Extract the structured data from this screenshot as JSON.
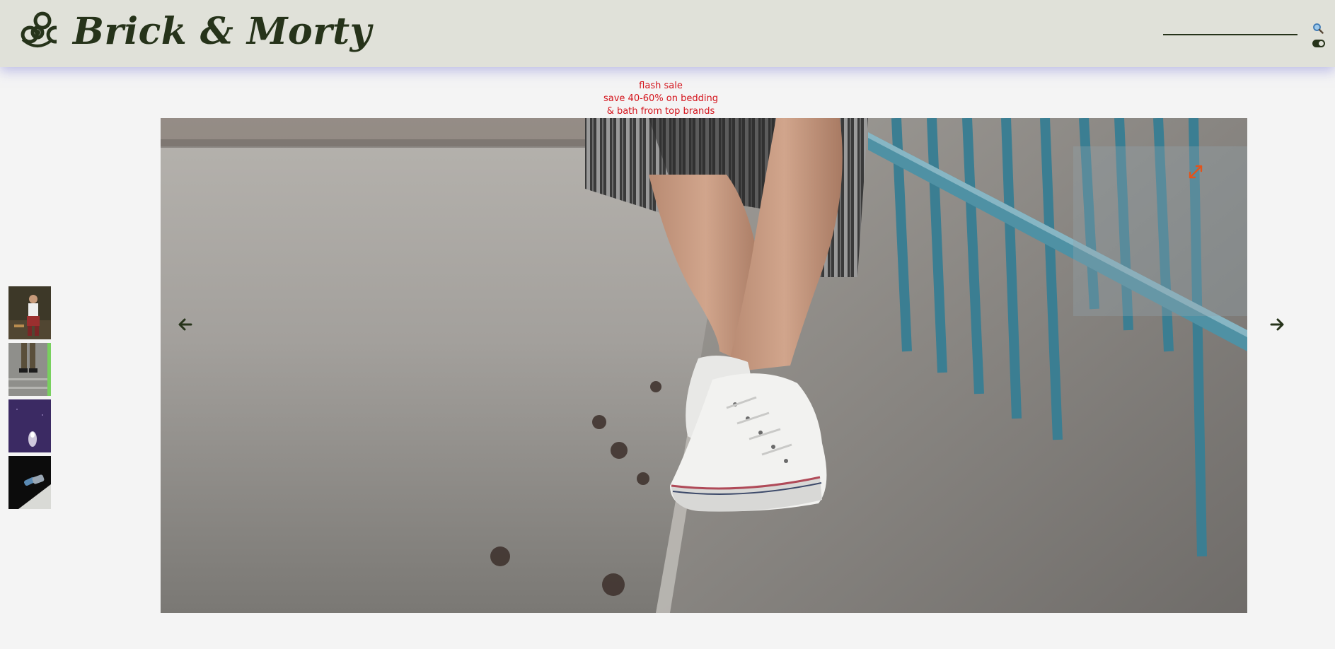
{
  "header": {
    "brand": "Brick & Morty",
    "logo_icon": "biohazard-icon",
    "search": {
      "value": "",
      "placeholder": "",
      "icon": "search-icon"
    },
    "theme_toggle_icon": "toggle-icon"
  },
  "promo": {
    "line1": "flash sale",
    "line2": "save 40-60% on bedding",
    "line3": "& bath from top brands",
    "color": "#d4141c"
  },
  "gallery": {
    "thumbnails": [
      {
        "name": "thumbnail-1",
        "active": false
      },
      {
        "name": "thumbnail-2",
        "active": true
      },
      {
        "name": "thumbnail-3",
        "active": false
      },
      {
        "name": "thumbnail-4",
        "active": false
      }
    ],
    "active_index": 1,
    "prev_icon": "arrow-left-icon",
    "next_icon": "arrow-right-icon",
    "expand_icon": "expand-icon"
  },
  "colors": {
    "header_bg": "#e0e1d9",
    "brand": "#26331a",
    "accent_active": "#78d05e",
    "page_bg": "#f4f4f4"
  }
}
